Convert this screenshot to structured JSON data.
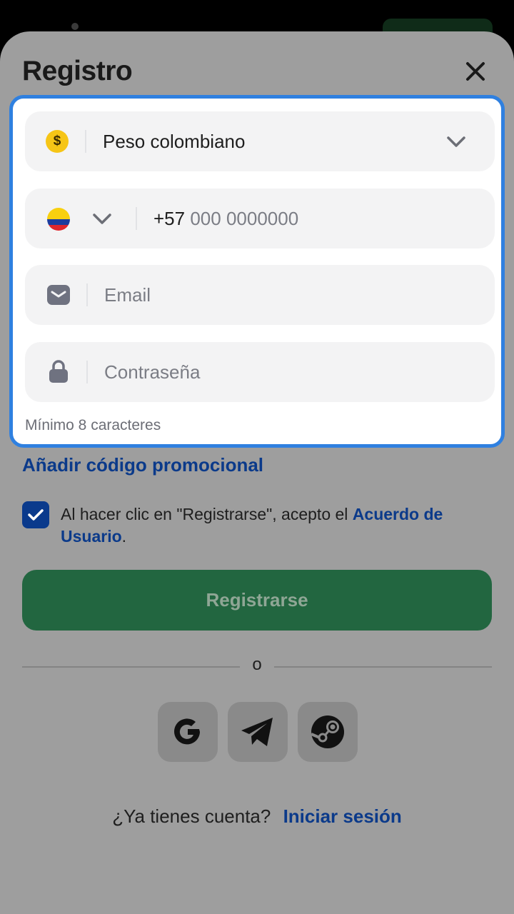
{
  "header": {
    "title": "Registro",
    "close_icon": "close-icon"
  },
  "form": {
    "currency": {
      "icon": "dollar-coin-icon",
      "icon_text": "$",
      "value": "Peso colombiano"
    },
    "phone": {
      "flag": "colombia-flag-icon",
      "prefix": "+57",
      "placeholder": "000 0000000"
    },
    "email": {
      "icon": "envelope-icon",
      "placeholder": "Email"
    },
    "password": {
      "icon": "lock-icon",
      "placeholder": "Contraseña",
      "hint": "Mínimo 8 caracteres"
    }
  },
  "promo_link": "Añadir código promocional",
  "consent": {
    "checked": true,
    "text": "Al hacer clic en \"Registrarse\", acepto el ",
    "link_text": "Acuerdo de Usuario",
    "suffix": "."
  },
  "register_button": "Registrarse",
  "divider_text": "o",
  "social": [
    "google-icon",
    "telegram-icon",
    "steam-icon"
  ],
  "login": {
    "prompt": "¿Ya tienes cuenta?",
    "link": "Iniciar sesión"
  },
  "colors": {
    "accent_blue": "#0b3a8a",
    "highlight_border": "#2f80e0",
    "primary_green": "#226640",
    "overlay_gray": "#9e9e9e"
  }
}
